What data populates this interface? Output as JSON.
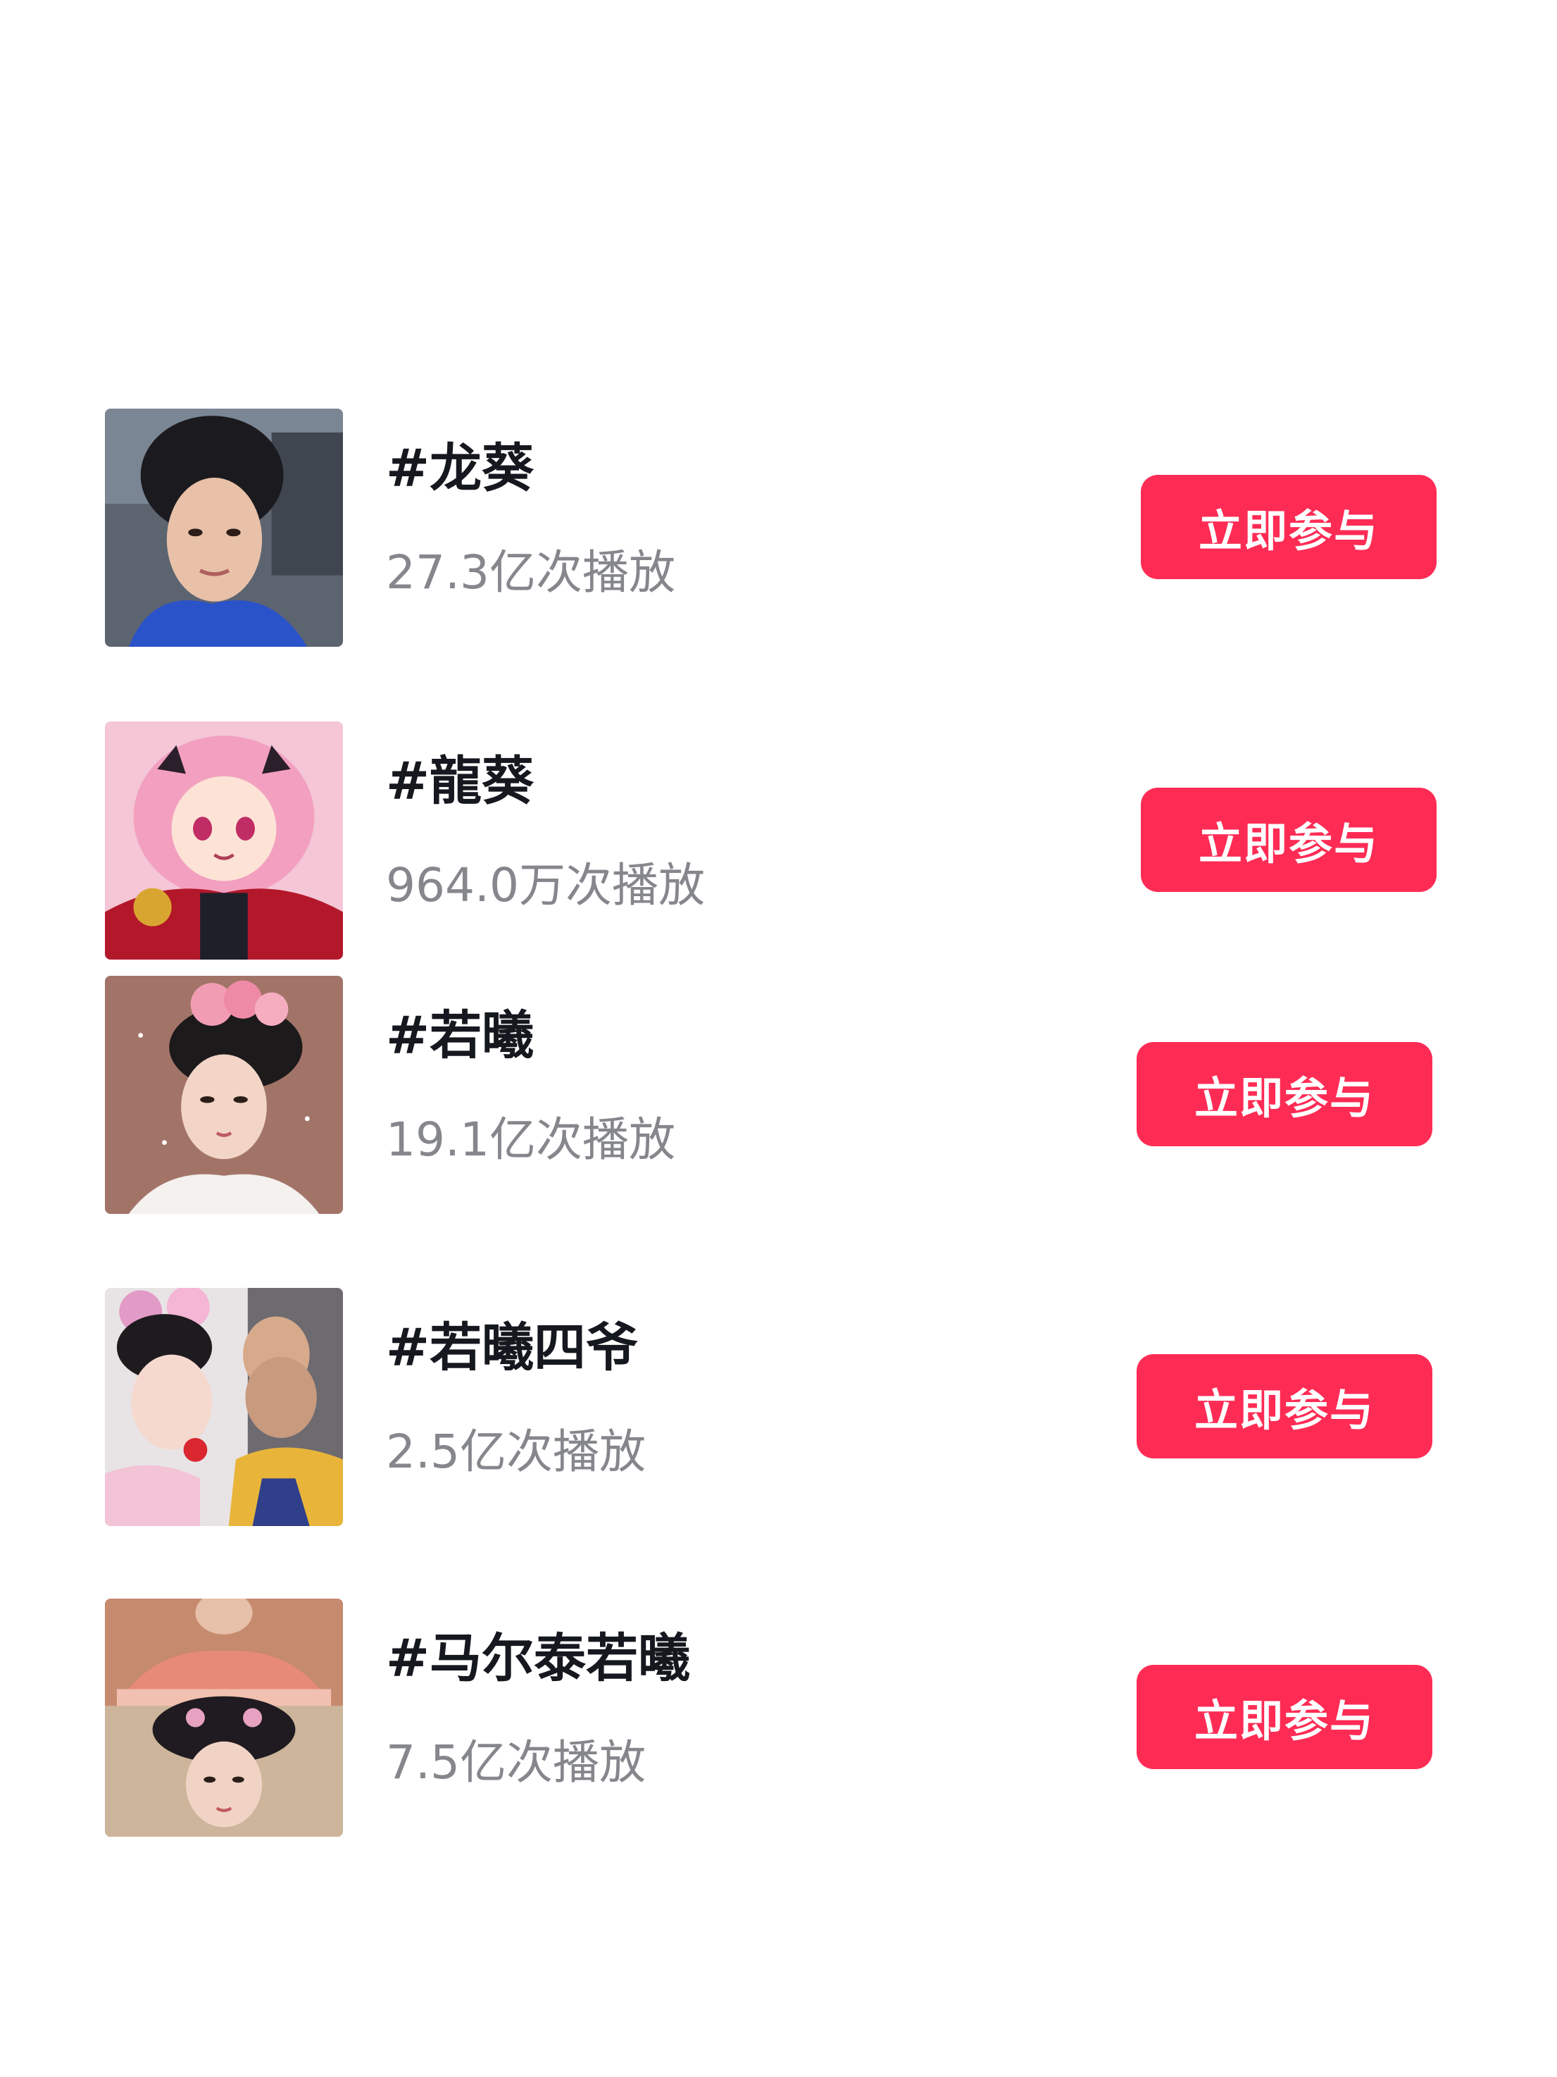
{
  "theme": {
    "accent": "#fe2c55",
    "title_color": "#16181f",
    "subtitle_color": "#85878c",
    "background": "#ffffff"
  },
  "topics": [
    {
      "title": "#龙葵",
      "plays": "27.3亿次播放",
      "button_label": "立即参与",
      "thumbnail": "woman-with-dark-hair-portrait"
    },
    {
      "title": "#龍葵",
      "plays": "964.0万次播放",
      "button_label": "立即参与",
      "thumbnail": "pink-haired-anime-girl"
    },
    {
      "title": "#若曦",
      "plays": "19.1亿次播放",
      "button_label": "立即参与",
      "thumbnail": "woman-with-pink-flower-headdress"
    },
    {
      "title": "#若曦四爷",
      "plays": "2.5亿次播放",
      "button_label": "立即参与",
      "thumbnail": "couple-in-qing-costume"
    },
    {
      "title": "#马尔泰若曦",
      "plays": "7.5亿次播放",
      "button_label": "立即参与",
      "thumbnail": "women-in-qing-court-costume"
    }
  ]
}
